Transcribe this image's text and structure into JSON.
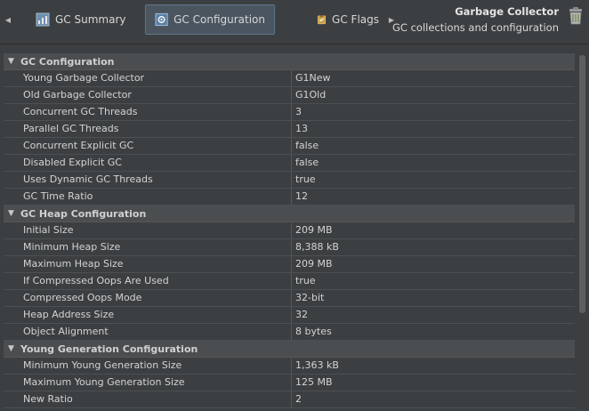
{
  "toolbar": {
    "tabs": [
      {
        "label": "GC Summary",
        "icon": "summary-chart-icon"
      },
      {
        "label": "GC Configuration",
        "icon": "configuration-icon",
        "selected": true
      },
      {
        "label": "GC Flags",
        "icon": "flags-clipboard-icon"
      }
    ],
    "title": "Garbage Collector",
    "subtitle": "GC collections and configuration",
    "right_icon": "trash-can-icon"
  },
  "sections": [
    {
      "title": "GC Configuration",
      "expanded": true,
      "rows": [
        {
          "name": "Young Garbage Collector",
          "value": "G1New"
        },
        {
          "name": "Old Garbage Collector",
          "value": "G1Old"
        },
        {
          "name": "Concurrent GC Threads",
          "value": "3"
        },
        {
          "name": "Parallel GC Threads",
          "value": "13"
        },
        {
          "name": "Concurrent Explicit GC",
          "value": "false"
        },
        {
          "name": "Disabled Explicit GC",
          "value": "false"
        },
        {
          "name": "Uses Dynamic GC Threads",
          "value": "true"
        },
        {
          "name": "GC Time Ratio",
          "value": "12"
        }
      ]
    },
    {
      "title": "GC Heap Configuration",
      "expanded": true,
      "rows": [
        {
          "name": "Initial Size",
          "value": "209 MB"
        },
        {
          "name": "Minimum Heap Size",
          "value": "8,388 kB"
        },
        {
          "name": "Maximum Heap Size",
          "value": "209 MB"
        },
        {
          "name": "If Compressed Oops Are Used",
          "value": "true"
        },
        {
          "name": "Compressed Oops Mode",
          "value": "32-bit"
        },
        {
          "name": "Heap Address Size",
          "value": "32"
        },
        {
          "name": "Object Alignment",
          "value": "8 bytes"
        }
      ]
    },
    {
      "title": "Young Generation Configuration",
      "expanded": true,
      "rows": [
        {
          "name": "Minimum Young Generation Size",
          "value": "1,363 kB"
        },
        {
          "name": "Maximum Young Generation Size",
          "value": "125 MB"
        },
        {
          "name": "New Ratio",
          "value": "2"
        }
      ]
    }
  ],
  "colors": {
    "background": "#3c3f41",
    "section_header": "#4b4e50",
    "selected_tab": "#4a5560",
    "text": "#d3d3d3"
  }
}
